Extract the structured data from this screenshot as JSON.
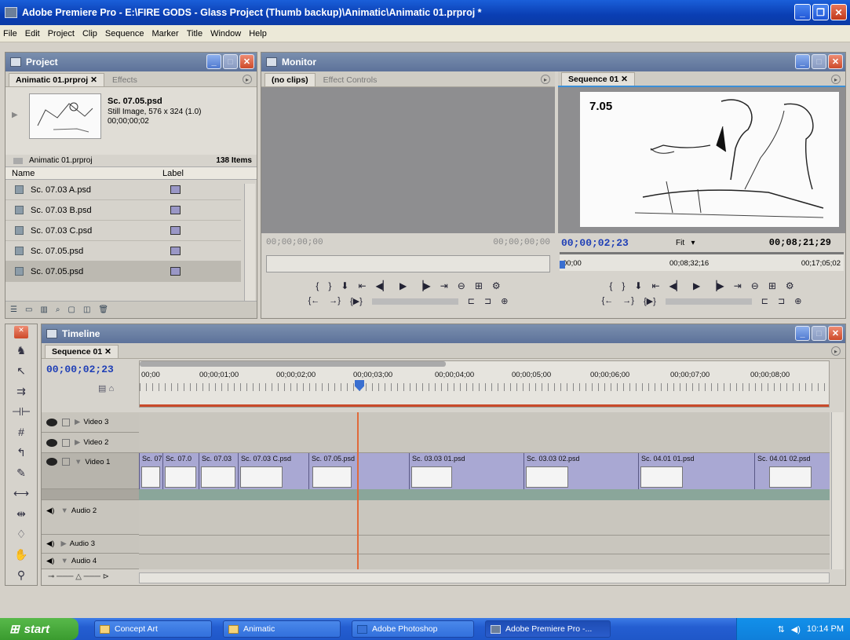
{
  "window": {
    "title": "Adobe Premiere Pro - E:\\FIRE GODS - Glass Project (Thumb backup)\\Animatic\\Animatic 01.prproj *"
  },
  "menu": [
    "File",
    "Edit",
    "Project",
    "Clip",
    "Sequence",
    "Marker",
    "Title",
    "Window",
    "Help"
  ],
  "project": {
    "panel_title": "Project",
    "tabs": [
      "Animatic 01.prproj",
      "Effects"
    ],
    "preview": {
      "name": "Sc. 07.05.psd",
      "info": "Still Image, 576 x 324 (1.0)",
      "duration": "00;00;00;02"
    },
    "bin_name": "Animatic 01.prproj",
    "item_count": "138 Items",
    "col_name": "Name",
    "col_label": "Label",
    "items": [
      "Sc. 07.03 A.psd",
      "Sc. 07.03 B.psd",
      "Sc. 07.03 C.psd",
      "Sc. 07.05.psd",
      "Sc. 07.05.psd"
    ],
    "label_color": "#9a97c6"
  },
  "monitor": {
    "panel_title": "Monitor",
    "source_tabs": [
      "(no clips)",
      "Effect Controls"
    ],
    "source_tc_left": "00;00;00;00",
    "source_tc_right": "00;00;00;00",
    "program_tab": "Sequence 01",
    "program_overlay": "7.05",
    "program_tc_left": "00;00;02;23",
    "zoom": "Fit",
    "program_tc_right": "00;08;21;29",
    "ruler": [
      "00;00",
      "00;08;32;16",
      "00;17;05;02"
    ]
  },
  "timeline": {
    "panel_title": "Timeline",
    "tab": "Sequence 01",
    "current_tc": "00;00;02;23",
    "ruler": [
      "00;00",
      "00;00;01;00",
      "00;00;02;00",
      "00;00;03;00",
      "00;00;04;00",
      "00;00;05;00",
      "00;00;06;00",
      "00;00;07;00",
      "00;00;08;00"
    ],
    "tracks": [
      "Video 3",
      "Video 2",
      "Video 1",
      "Audio 2",
      "Audio 3",
      "Audio 4"
    ],
    "clips": [
      "Sc. 07",
      "Sc. 07.0",
      "Sc. 07.03",
      "Sc. 07.03 C.psd",
      "Sc. 07.05.psd",
      "Sc. 03.03 01.psd",
      "Sc. 03.03 02.psd",
      "Sc. 04.01 01.psd",
      "Sc. 04.01 02.psd"
    ]
  },
  "taskbar": {
    "start": "start",
    "items": [
      "Concept Art",
      "Animatic",
      "Adobe Photoshop",
      "Adobe Premiere Pro -..."
    ],
    "clock": "10:14 PM"
  }
}
